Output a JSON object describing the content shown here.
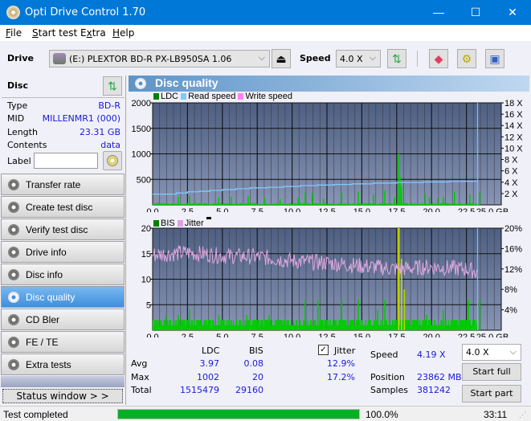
{
  "window": {
    "title": "Opti Drive Control 1.70",
    "minimize": "—",
    "maximize": "☐",
    "close": "✕"
  },
  "menu": [
    {
      "label": "File",
      "accel": "F",
      "rest": "ile"
    },
    {
      "label": "Start test",
      "accel": "S",
      "rest": "tart test"
    },
    {
      "label": "Extra",
      "accel": "x",
      "pre": "E",
      "rest": "tra"
    },
    {
      "label": "Help",
      "accel": "H",
      "rest": "elp"
    }
  ],
  "toolbar": {
    "drive_label": "Drive",
    "drive_value": "(E:)  PLEXTOR BD-R  PX-LB950SA 1.06",
    "speed_label": "Speed",
    "speed_value": "4.0 X"
  },
  "disc": {
    "title": "Disc",
    "fields": [
      {
        "label": "Type",
        "value": "BD-R"
      },
      {
        "label": "MID",
        "value": "MILLENMR1 (000)"
      },
      {
        "label": "Length",
        "value": "23.31 GB"
      },
      {
        "label": "Contents",
        "value": "data"
      }
    ],
    "label_field": "Label",
    "label_value": ""
  },
  "nav": [
    {
      "label": "Transfer rate",
      "active": false
    },
    {
      "label": "Create test disc",
      "active": false
    },
    {
      "label": "Verify test disc",
      "active": false
    },
    {
      "label": "Drive info",
      "active": false
    },
    {
      "label": "Disc info",
      "active": false
    },
    {
      "label": "Disc quality",
      "active": true
    },
    {
      "label": "CD Bler",
      "active": false
    },
    {
      "label": "FE / TE",
      "active": false
    },
    {
      "label": "Extra tests",
      "active": false
    }
  ],
  "status_window_button": "Status window > >",
  "panel_title": "Disc quality",
  "chart_data": [
    {
      "type": "bar",
      "title": "LDC / Read speed",
      "legend": [
        {
          "name": "LDC",
          "color": "#008000"
        },
        {
          "name": "Read speed",
          "color": "#80c8ff"
        },
        {
          "name": "Write speed",
          "color": "#ff80ff"
        }
      ],
      "legend_placement": "top-left",
      "xlabel": "GB",
      "xlim": [
        0,
        25
      ],
      "x_ticks": [
        "0.0",
        "2.5",
        "5.0",
        "7.5",
        "10.0",
        "12.5",
        "15.0",
        "17.5",
        "20.0",
        "22.5",
        "25.0 GB"
      ],
      "ylim": [
        0,
        2000
      ],
      "y_ticks": [
        "500",
        "1000",
        "1500",
        "2000"
      ],
      "y2lim": [
        0,
        18
      ],
      "y2_ticks": [
        "2 X",
        "4 X",
        "6 X",
        "8 X",
        "10 X",
        "12 X",
        "14 X",
        "16 X",
        "18 X"
      ],
      "grid": true,
      "ldc_spikes": [
        [
          0.3,
          40
        ],
        [
          1.8,
          160
        ],
        [
          2.6,
          180
        ],
        [
          3.0,
          60
        ],
        [
          4.7,
          150
        ],
        [
          5.6,
          160
        ],
        [
          6.8,
          170
        ],
        [
          8.0,
          140
        ],
        [
          9.1,
          110
        ],
        [
          10.4,
          140
        ],
        [
          10.9,
          260
        ],
        [
          11.4,
          230
        ],
        [
          12.2,
          120
        ],
        [
          13.5,
          250
        ],
        [
          14.7,
          260
        ],
        [
          15.8,
          210
        ],
        [
          16.6,
          280
        ],
        [
          17.3,
          150
        ],
        [
          17.6,
          1002
        ],
        [
          17.7,
          550
        ],
        [
          17.8,
          360
        ],
        [
          19.5,
          230
        ],
        [
          19.8,
          150
        ],
        [
          20.4,
          130
        ],
        [
          20.8,
          150
        ],
        [
          21.6,
          260
        ],
        [
          22.7,
          200
        ],
        [
          23.4,
          250
        ]
      ],
      "read_speed": {
        "x": [
          0,
          1.7,
          2.5,
          3.3,
          4.1,
          5.0,
          6.0,
          7.0,
          8.2,
          9.4,
          10.6,
          11.8,
          13.0,
          14.3,
          15.8,
          17.5,
          19.4,
          21.3,
          23.3
        ],
        "y": [
          1.9,
          2.1,
          2.3,
          2.4,
          2.55,
          2.7,
          2.85,
          3.0,
          3.1,
          3.25,
          3.4,
          3.5,
          3.6,
          3.7,
          3.85,
          3.95,
          4.05,
          4.15,
          4.25
        ]
      }
    },
    {
      "type": "bar",
      "title": "BIS / Jitter",
      "legend": [
        {
          "name": "BIS",
          "color": "#008000"
        },
        {
          "name": "Jitter",
          "color": "#e0a0e0"
        }
      ],
      "legend_placement": "top-left",
      "xlabel": "GB",
      "xlim": [
        0,
        25
      ],
      "x_ticks": [
        "0.0",
        "2.5",
        "5.0",
        "7.5",
        "10.0",
        "12.5",
        "15.0",
        "17.5",
        "20.0",
        "22.5",
        "25.0 GB"
      ],
      "ylim": [
        0,
        20
      ],
      "y_ticks": [
        "5",
        "10",
        "15",
        "20"
      ],
      "y2lim": [
        0,
        20
      ],
      "y2_ticks": [
        "4%",
        "8%",
        "12%",
        "16%",
        "20%"
      ],
      "grid": true,
      "bis_baseline": 2,
      "bis_spikes": [
        [
          0.9,
          3
        ],
        [
          1.8,
          3
        ],
        [
          2.6,
          4
        ],
        [
          4.7,
          3
        ],
        [
          6.7,
          3
        ],
        [
          8.3,
          3
        ],
        [
          10.9,
          6
        ],
        [
          11.8,
          6
        ],
        [
          13.5,
          6
        ],
        [
          14.7,
          6
        ],
        [
          16.1,
          4
        ],
        [
          16.6,
          6
        ],
        [
          17.6,
          20
        ],
        [
          17.8,
          14
        ],
        [
          18.0,
          8
        ],
        [
          19.6,
          3
        ],
        [
          20.8,
          4
        ],
        [
          22.6,
          6
        ],
        [
          23.4,
          6
        ]
      ],
      "jitter_trend": {
        "x": [
          0,
          2.5,
          5.0,
          7.5,
          10.0,
          12.5,
          15.0,
          17.5,
          20.0,
          22.5,
          23.3
        ],
        "y": [
          14.8,
          15.2,
          14.6,
          14.4,
          13.6,
          13.2,
          12.6,
          12.0,
          12.4,
          12.0,
          11.4
        ]
      }
    }
  ],
  "stats": {
    "col_ldc": "LDC",
    "col_bis": "BIS",
    "jitter_label": "Jitter",
    "jitter_checked": true,
    "rows": [
      {
        "label": "Avg",
        "ldc": "3.97",
        "bis": "0.08",
        "jitter": "12.9%"
      },
      {
        "label": "Max",
        "ldc": "1002",
        "bis": "20",
        "jitter": "17.2%"
      },
      {
        "label": "Total",
        "ldc": "1515479",
        "bis": "29160",
        "jitter": ""
      }
    ],
    "speed_label": "Speed",
    "speed_value": "4.19 X",
    "position_label": "Position",
    "position_value": "23862 MB",
    "samples_label": "Samples",
    "samples_value": "381242",
    "speed_select": "4.0 X",
    "start_full": "Start full",
    "start_part": "Start part"
  },
  "status": {
    "text": "Test completed",
    "progress": 1.0,
    "progress_text": "100.0%",
    "time": "33:11"
  }
}
